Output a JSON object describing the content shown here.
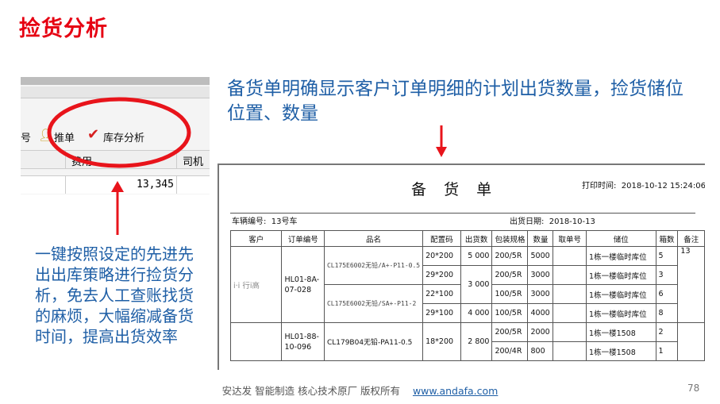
{
  "title": "捡货分析",
  "screenshot": {
    "toolbar": {
      "left_fragment": "号",
      "push_label": "推单",
      "stock_label": "库存分析"
    },
    "header": {
      "cost": "费用",
      "driver": "司机"
    },
    "value": "13,345"
  },
  "caption": "备货单明确显示客户订单明细的计划出货数量，捡货储位位置、数量",
  "description": "一键按照设定的先进先出出库策略进行捡货分析，免去人工查账找货的麻烦，大幅缩减备货时间，提高出货效率",
  "document": {
    "title": "备 货 单",
    "print_time_label": "打印时间:",
    "print_time": "2018-10-12 15:24:06",
    "vehicle_label": "车辆编号:",
    "vehicle": "13号车",
    "ship_date_label": "出货日期:",
    "ship_date": "2018-10-13",
    "columns": [
      "客户",
      "订单编号",
      "品名",
      "配置码",
      "出货数",
      "包装规格",
      "数量",
      "取单号",
      "储位",
      "箱数",
      "备注"
    ],
    "customer": "i·i 行i高",
    "orders": [
      {
        "id": "HL01-8A-07-028"
      },
      {
        "id": "HL01-88-10-096"
      }
    ],
    "products": [
      "CL175E6002无铅/A+-P11-0.5",
      "CL175E6002无铅/SA+-P11-2",
      "CL179B04无铅-PA11-0.5"
    ],
    "rows": [
      {
        "code": "20*200",
        "ship": "5 000",
        "pack": "200/5R",
        "qty": "5000",
        "loc": "1栋一楼临时库位",
        "box": "5",
        "note": "13"
      },
      {
        "code": "29*200",
        "ship": "",
        "pack": "200/5R",
        "qty": "3000",
        "loc": "1栋一楼临时库位",
        "box": "3",
        "note": ""
      },
      {
        "code": "22*100",
        "ship": "3 000",
        "pack": "100/5R",
        "qty": "3000",
        "loc": "1栋一楼临时库位",
        "box": "6",
        "note": ""
      },
      {
        "code": "29*100",
        "ship": "4 000",
        "pack": "100/5R",
        "qty": "4000",
        "loc": "1栋一楼临时库位",
        "box": "8",
        "note": ""
      },
      {
        "code": "18*200",
        "ship": "2 800",
        "pack": "200/5R",
        "qty": "2000",
        "loc": "1栋一楼1508",
        "box": "2",
        "note": ""
      },
      {
        "code": "",
        "ship": "",
        "pack": "200/4R",
        "qty": "800",
        "loc": "1栋一楼1508",
        "box": "1",
        "note": ""
      }
    ]
  },
  "footer": {
    "text": "安达发   智能制造 核心技术原厂    版权所有",
    "link": "www.andafa.com",
    "page": "78"
  },
  "colors": {
    "title": "#e60012",
    "accent_blue": "#1f5fa6",
    "annotation_red": "#e8141b"
  }
}
